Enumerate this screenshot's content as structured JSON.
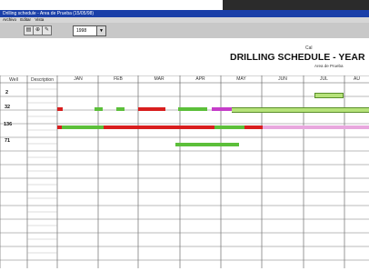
{
  "window": {
    "title": "Drilling schedule - Area de Prueba (15/05/98)"
  },
  "menu": [
    "Archivo",
    "Editar",
    "Vista"
  ],
  "toolbar": {
    "year_value": "1998"
  },
  "document": {
    "logo_text": "Cal",
    "title": "DRILLING SCHEDULE - YEAR",
    "subtitle": "Area de Prueba"
  },
  "table": {
    "col_headers": [
      "Well",
      "Description"
    ],
    "months": [
      "JAN",
      "FEB",
      "MAR",
      "APR",
      "MAY",
      "JUN",
      "JUL",
      "AU"
    ],
    "well_rows": [
      "2",
      "32",
      "136",
      "71"
    ]
  },
  "colors": {
    "green": "#5cbf3a",
    "red": "#d81e1e",
    "magenta": "#c53dc9",
    "pink": "#e8a7de",
    "lightgreen": "#b6e27a"
  }
}
